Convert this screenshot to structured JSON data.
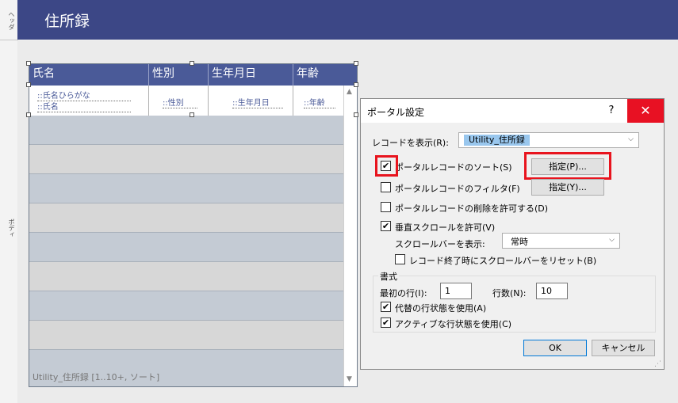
{
  "ruler": {
    "header_label": "ヘッダ",
    "body_label": "ボディ"
  },
  "header": {
    "title": "住所録"
  },
  "portal": {
    "columns": [
      "氏名",
      "性別",
      "生年月日",
      "年齢"
    ],
    "fields": {
      "name_kana": "::氏名ひらがな",
      "name": "::氏名",
      "gender": "::性別",
      "birthdate": "::生年月日",
      "age": "::年齢"
    },
    "footer": "Utility_住所録 [1..10+, ソート]"
  },
  "dialog": {
    "title": "ポータル設定",
    "help": "?",
    "close": "✕",
    "show_records_label": "レコードを表示(R):",
    "show_records_value": "Utility_住所録",
    "sort_label": "ポータルレコードのソート(S)",
    "sort_checked": true,
    "sort_button": "指定(P)...",
    "filter_label": "ポータルレコードのフィルタ(F)",
    "filter_checked": false,
    "filter_button": "指定(Y)...",
    "delete_label": "ポータルレコードの削除を許可する(D)",
    "delete_checked": false,
    "vscroll_label": "垂直スクロールを許可(V)",
    "vscroll_checked": true,
    "scrollbar_label": "スクロールバーを表示:",
    "scrollbar_value": "常時",
    "reset_label": "レコード終了時にスクロールバーをリセット(B)",
    "reset_checked": false,
    "format_group": "書式",
    "first_row_label": "最初の行(I):",
    "first_row_value": "1",
    "rows_label": "行数(N):",
    "rows_value": "10",
    "alt_label": "代替の行状態を使用(A)",
    "alt_checked": true,
    "active_label": "アクティブな行状態を使用(C)",
    "active_checked": true,
    "ok": "OK",
    "cancel": "キャンセル"
  },
  "colors": {
    "header_bg": "#3c4786",
    "highlight": "#e8141e",
    "close_bg": "#e81123"
  }
}
